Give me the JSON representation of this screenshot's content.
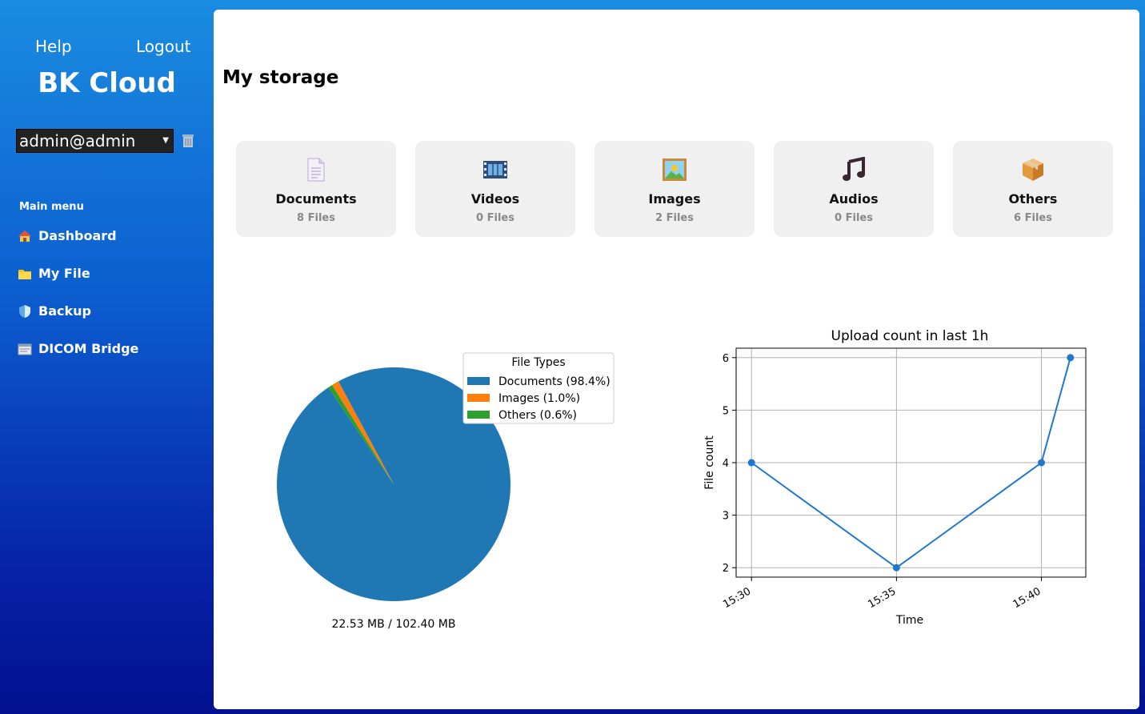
{
  "sidebar": {
    "help_label": "Help",
    "logout_label": "Logout",
    "brand": "BK Cloud",
    "account": "admin@admin",
    "menu_title": "Main menu",
    "items": [
      {
        "label": "Dashboard",
        "icon": "house-icon"
      },
      {
        "label": "My File",
        "icon": "folder-icon"
      },
      {
        "label": "Backup",
        "icon": "shield-icon"
      },
      {
        "label": "DICOM Bridge",
        "icon": "window-icon"
      }
    ]
  },
  "main": {
    "title": "My storage",
    "cards": [
      {
        "name": "Documents",
        "count": "8 Files",
        "icon": "document-icon"
      },
      {
        "name": "Videos",
        "count": "0 Files",
        "icon": "film-icon"
      },
      {
        "name": "Images",
        "count": "2 Files",
        "icon": "picture-icon"
      },
      {
        "name": "Audios",
        "count": "0 Files",
        "icon": "music-note-icon"
      },
      {
        "name": "Others",
        "count": "6 Files",
        "icon": "package-icon"
      }
    ],
    "storage_caption": "22.53 MB / 102.40 MB"
  },
  "colors": {
    "series_blue": "#1f77b4",
    "series_orange": "#ff7f0e",
    "series_green": "#2ca02c",
    "line_blue": "#1f77d0"
  },
  "chart_data": [
    {
      "type": "pie",
      "legend_title": "File Types",
      "legend_position": "top-right",
      "slices": [
        {
          "label": "Documents (98.4%)",
          "value": 98.4
        },
        {
          "label": "Images (1.0%)",
          "value": 1.0
        },
        {
          "label": "Others (0.6%)",
          "value": 0.6
        }
      ]
    },
    {
      "type": "line",
      "title": "Upload count in last 1h",
      "xlabel": "Time",
      "ylabel": "File count",
      "x_ticks": [
        "15:30",
        "15:35",
        "15:40"
      ],
      "y_ticks": [
        2,
        3,
        4,
        5,
        6
      ],
      "x": [
        "15:30",
        "15:35",
        "15:40",
        "15:41"
      ],
      "y": [
        4,
        2,
        4,
        6
      ],
      "grid": true
    }
  ]
}
